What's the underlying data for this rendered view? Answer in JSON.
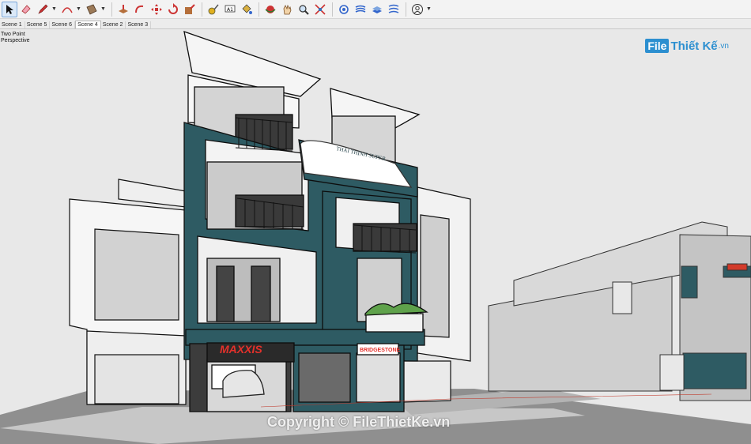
{
  "toolbar": {
    "tools": [
      "select-icon",
      "eraser-icon",
      "pencil-icon",
      "arc-icon",
      "rectangle-icon",
      "push-pull-icon",
      "follow-me-icon",
      "move-icon",
      "rotate-icon",
      "scale-icon",
      "tape-measure-icon",
      "text-icon",
      "paint-bucket-icon",
      "orbit-icon",
      "pan-icon",
      "zoom-icon",
      "zoom-extents-icon",
      "sandbox-icon",
      "layers-icon",
      "styles-icon",
      "section-icon",
      "account-icon"
    ]
  },
  "scenes": {
    "tabs": [
      "Scene 1",
      "Scene 5",
      "Scene 6",
      "Scene 4",
      "Scene 2",
      "Scene 3"
    ],
    "active": "Scene 4"
  },
  "viewport": {
    "camera_line1": "Two Point",
    "camera_line2": "Perspective"
  },
  "logo": {
    "box": "File",
    "text": "Thiết Kế",
    "suffix": ".vn"
  },
  "building": {
    "sign_main": "MAXXIS",
    "sign_brand": "BRIDGESTONE",
    "sign_company": "THÁI THỊNH SUPER"
  },
  "watermark": "Copyright © FileThietKe.vn",
  "colors": {
    "teal": "#2e5b63",
    "accent": "#e4312b",
    "brand_blue": "#2c8fd0"
  }
}
